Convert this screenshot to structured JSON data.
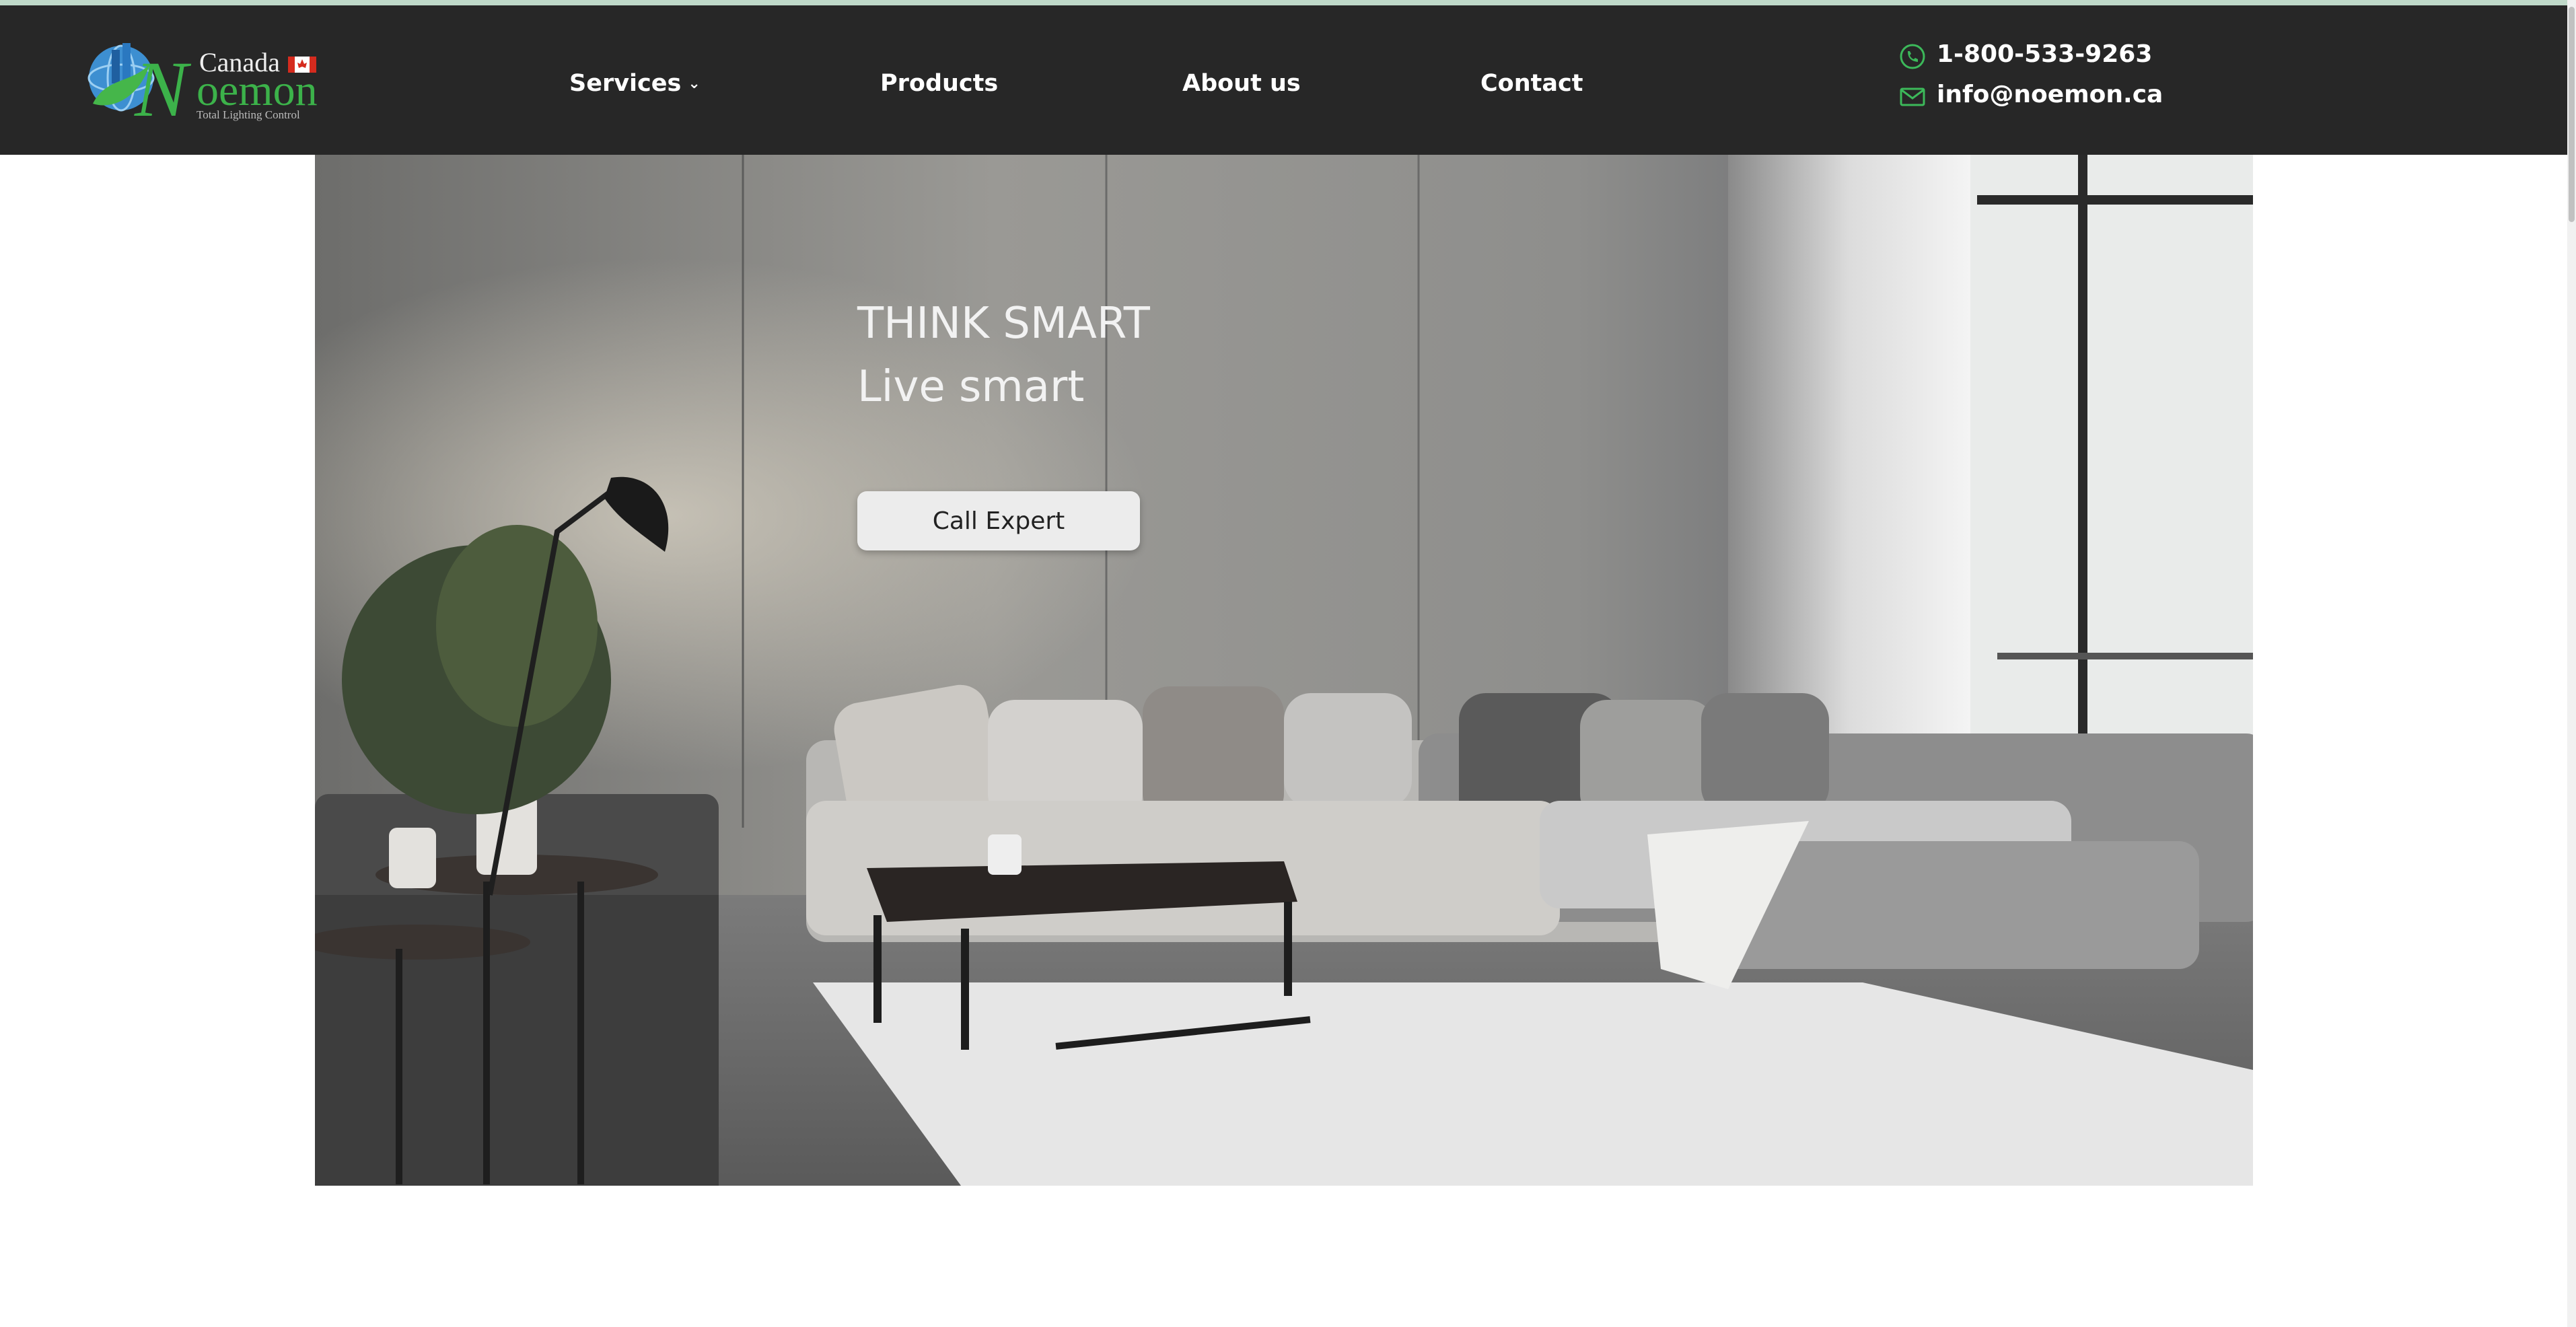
{
  "header": {
    "brand": {
      "country": "Canada",
      "name": "Noemon",
      "tagline": "Total Lighting Control"
    },
    "nav": [
      {
        "label": "Services",
        "has_dropdown": true
      },
      {
        "label": "Products"
      },
      {
        "label": "About us"
      },
      {
        "label": "Contact"
      }
    ],
    "contact": {
      "phone": "1-800-533-9263",
      "email": "info@noemon.ca",
      "phone_icon": "phone-icon",
      "email_icon": "mail-icon",
      "icon_color": "#3cb95a"
    },
    "background_color": "#272727"
  },
  "hero": {
    "headline_line1": "THINK SMART",
    "headline_line2": "Live smart",
    "cta_label": "Call Expert"
  }
}
